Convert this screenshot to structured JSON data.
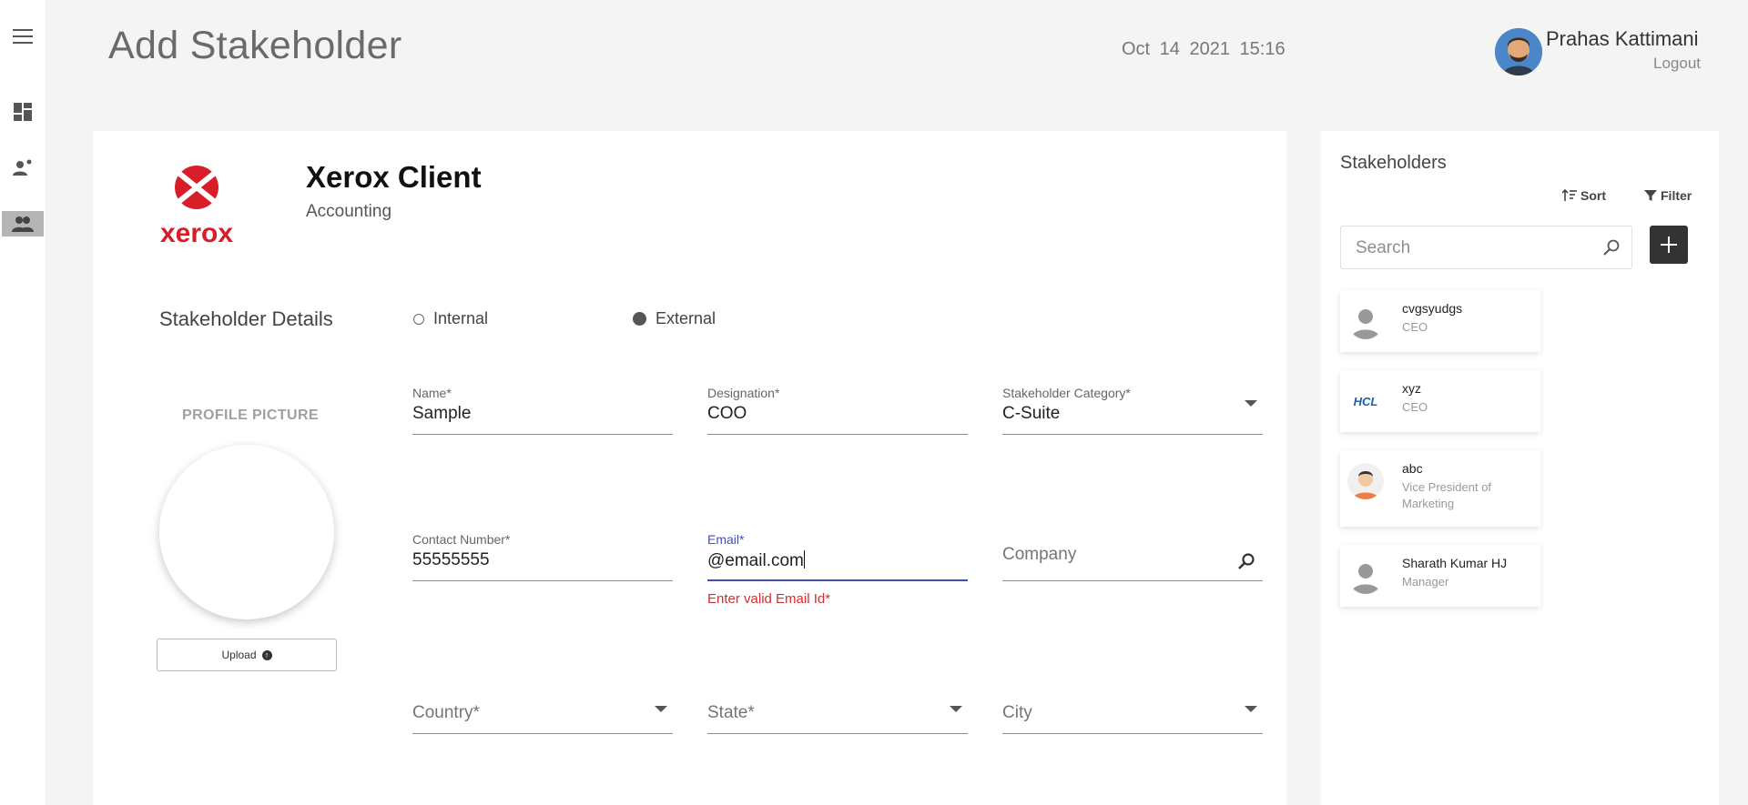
{
  "header": {
    "title": "Add Stakeholder",
    "datetime": "Oct 14 2021  15:16",
    "user_name": "Prahas Kattimani",
    "logout_label": "Logout"
  },
  "sidebar": {
    "items": [
      {
        "icon": "menu-icon"
      },
      {
        "icon": "dashboard-icon"
      },
      {
        "icon": "person-add-icon"
      },
      {
        "icon": "people-icon",
        "active": true
      }
    ]
  },
  "client": {
    "logo_text": "xerox",
    "name": "Xerox Client",
    "department": "Accounting"
  },
  "form": {
    "section_title": "Stakeholder Details",
    "type_options": [
      {
        "label": "Internal",
        "selected": false
      },
      {
        "label": "External",
        "selected": true
      }
    ],
    "profile_picture_label": "PROFILE PICTURE",
    "upload_label": "Upload",
    "fields": {
      "name": {
        "label": "Name*",
        "value": "Sample"
      },
      "designation": {
        "label": "Designation*",
        "value": "COO"
      },
      "category": {
        "label": "Stakeholder Category*",
        "value": "C-Suite"
      },
      "contact": {
        "label": "Contact Number*",
        "value": "55555555"
      },
      "email": {
        "label": "Email*",
        "value": "@email.com",
        "error": "Enter valid Email Id*"
      },
      "company": {
        "placeholder": "Company"
      },
      "country": {
        "placeholder": "Country*"
      },
      "state": {
        "placeholder": "State*"
      },
      "city": {
        "placeholder": "City"
      }
    }
  },
  "stakeholders_panel": {
    "title": "Stakeholders",
    "sort_label": "Sort",
    "filter_label": "Filter",
    "search_placeholder": "Search",
    "items": [
      {
        "name": "cvgsyudgs",
        "role": "CEO",
        "avatar": "default"
      },
      {
        "name": "xyz",
        "role": "CEO",
        "avatar": "hcl-logo"
      },
      {
        "name": "abc",
        "role": "Vice President of Marketing",
        "avatar": "cartoon"
      },
      {
        "name": "Sharath Kumar HJ",
        "role": "Manager",
        "avatar": "default"
      }
    ],
    "hcl_logo_text": "HCL"
  },
  "colors": {
    "accent": "#3f51b5",
    "error": "#d32f2f",
    "brand_red": "#d71e28"
  }
}
